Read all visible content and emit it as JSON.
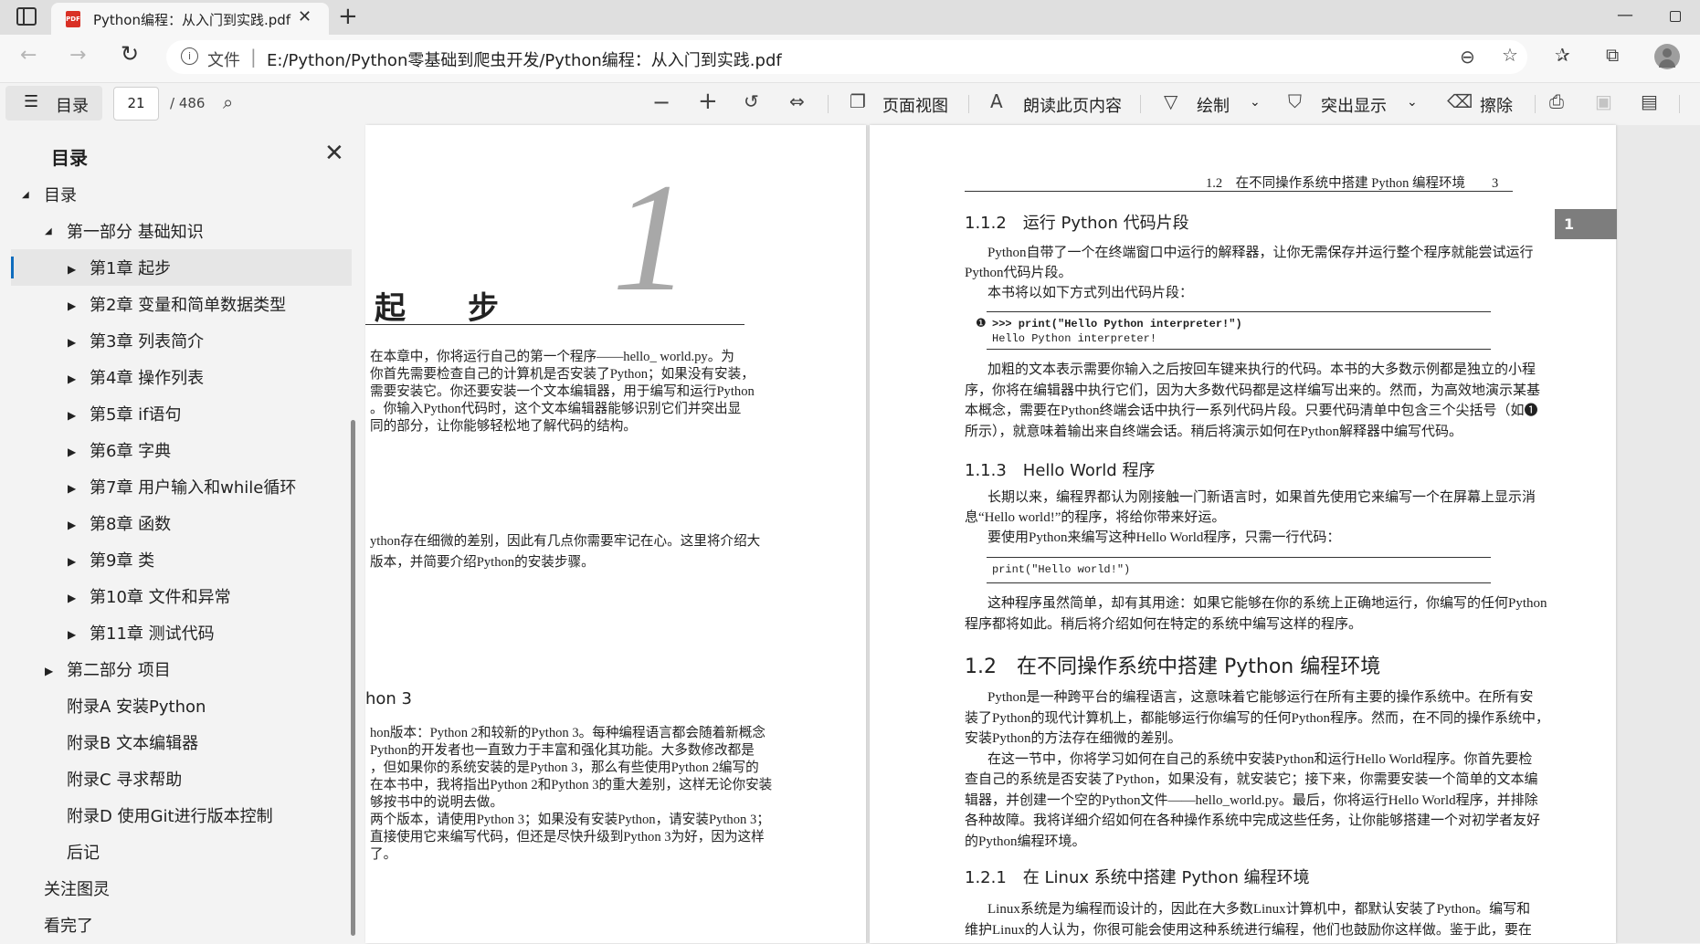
{
  "browser": {
    "tab_title": "Python编程：从入门到实践.pdf",
    "tab_icon_text": "PDF",
    "address_label": "文件",
    "address_url": "E:/Python/Python零基础到爬虫开发/Python编程：从入门到实践.pdf"
  },
  "pdf_toolbar": {
    "toc_label": "目录",
    "page_current": "21",
    "page_total": "/ 486",
    "page_view_label": "页面视图",
    "read_aloud_label": "朗读此页内容",
    "draw_label": "绘制",
    "highlight_label": "突出显示",
    "erase_label": "擦除"
  },
  "sidebar": {
    "title": "目录",
    "items": [
      {
        "label": "目录"
      },
      {
        "label": "第一部分 基础知识"
      },
      {
        "label": "第1章 起步"
      },
      {
        "label": "第2章 变量和简单数据类型"
      },
      {
        "label": "第3章 列表简介"
      },
      {
        "label": "第4章 操作列表"
      },
      {
        "label": "第5章 if语句"
      },
      {
        "label": "第6章 字典"
      },
      {
        "label": "第7章 用户输入和while循环"
      },
      {
        "label": "第8章 函数"
      },
      {
        "label": "第9章 类"
      },
      {
        "label": "第10章 文件和异常"
      },
      {
        "label": "第11章 测试代码"
      },
      {
        "label": "第二部分 项目"
      },
      {
        "label": "附录A 安装Python"
      },
      {
        "label": "附录B 文本编辑器"
      },
      {
        "label": "附录C 寻求帮助"
      },
      {
        "label": "附录D 使用Git进行版本控制"
      },
      {
        "label": "后记"
      },
      {
        "label": "关注图灵"
      },
      {
        "label": "看完了"
      }
    ]
  },
  "page1": {
    "chapter_title": "起　　步",
    "chapter_number": "1",
    "intro_lines": [
      "在本章中，你将运行自己的第一个程序——hello_ world.py。为",
      "你首先需要检查自己的计算机是否安装了Python；如果没有安装，",
      "需要安装它。你还要安装一个文本编辑器，用于编写和运行Python",
      "。你输入Python代码时，这个文本编辑器能够识别它们并突出显",
      "同的部分，让你能够轻松地了解代码的结构。"
    ],
    "section_lines": [
      "ython存在细微的差别，因此有几点你需要牢记在心。这里将介绍大",
      "版本，并简要介绍Python的安装步骤。"
    ],
    "subheading": "hon 3",
    "body_lines": [
      "hon版本：Python 2和较新的Python 3。每种编程语言都会随着新概念",
      "Python的开发者也一直致力于丰富和强化其功能。大多数修改都是",
      "，但如果你的系统安装的是Python 3，那么有些使用Python 2编写的",
      "在本书中，我将指出Python 2和Python 3的重大差别，这样无论你安装",
      "够按书中的说明去做。",
      "两个版本，请使用Python 3；如果没有安装Python，请安装Python 3；",
      "直接使用它来编写代码，但还是尽快升级到Python 3为好，因为这样",
      "了。"
    ]
  },
  "page2": {
    "running_header": "1.2　在不同操作系统中搭建 Python 编程环境　　3",
    "side_tab": "1",
    "h_112": "1.1.2　运行 Python 代码片段",
    "p_112": [
      "Python自带了一个在终端窗口中运行的解释器，让你无需保存并运行整个程序就能尝试运行",
      "Python代码片段。",
      "本书将以如下方式列出代码片段："
    ],
    "code1_marker": "❶",
    "code1_line1": ">>> print(\"Hello Python interpreter!\")",
    "code1_line2": "Hello Python interpreter!",
    "p_112b": [
      "加粗的文本表示需要你输入之后按回车键来执行的代码。本书的大多数示例都是独立的小程",
      "序，你将在编辑器中执行它们，因为大多数代码都是这样编写出来的。然而，为高效地演示某基",
      "本概念，需要在Python终端会话中执行一系列代码片段。只要代码清单中包含三个尖括号（如❶",
      "所示），就意味着输出来自终端会话。稍后将演示如何在Python解释器中编写代码。"
    ],
    "h_113": "1.1.3　Hello World 程序",
    "p_113": [
      "长期以来，编程界都认为刚接触一门新语言时，如果首先使用它来编写一个在屏幕上显示消",
      "息“Hello world!”的程序，将给你带来好运。",
      "要使用Python来编写这种Hello World程序，只需一行代码："
    ],
    "code2": "print(\"Hello world!\")",
    "p_113b": [
      "这种程序虽然简单，却有其用途：如果它能够在你的系统上正确地运行，你编写的任何Python",
      "程序都将如此。稍后将介绍如何在特定的系统中编写这样的程序。"
    ],
    "h_12": "1.2　在不同操作系统中搭建 Python 编程环境",
    "p_12": [
      "Python是一种跨平台的编程语言，这意味着它能够运行在所有主要的操作系统中。在所有安",
      "装了Python的现代计算机上，都能够运行你编写的任何Python程序。然而，在不同的操作系统中，",
      "安装Python的方法存在细微的差别。",
      "在这一节中，你将学习如何在自己的系统中安装Python和运行Hello World程序。你首先要检",
      "查自己的系统是否安装了Python，如果没有，就安装它；接下来，你需要安装一个简单的文本编",
      "辑器，并创建一个空的Python文件——hello_world.py。最后，你将运行Hello World程序，并排除",
      "各种故障。我将详细介绍如何在各种操作系统中完成这些任务，让你能够搭建一个对初学者友好",
      "的Python编程环境。"
    ],
    "h_121": "1.2.1　在 Linux 系统中搭建 Python 编程环境",
    "p_121": [
      "Linux系统是为编程而设计的，因此在大多数Linux计算机中，都默认安装了Python。编写和",
      "维护Linux的人认为，你很可能会使用这种系统进行编程，他们也鼓励你这样做。鉴于此，要在"
    ]
  },
  "colors": {
    "accent": "#0f6cbd",
    "pdf_icon": "#d93025"
  }
}
